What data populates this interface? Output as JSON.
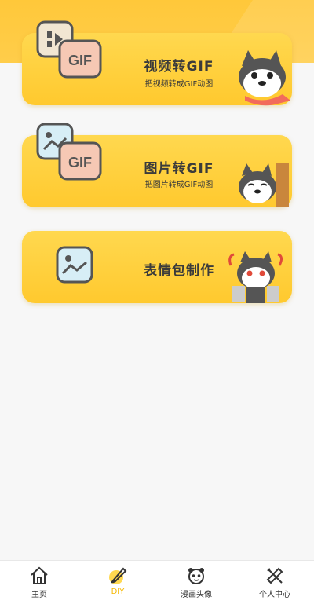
{
  "colors": {
    "accent": "#ffc92e",
    "header": "#ffc83a",
    "active_tab": "#f5b800",
    "text": "#3b3b3b"
  },
  "cards": [
    {
      "title": "视频转GIF",
      "subtitle": "把视频转成GIF动图",
      "badge": "GIF",
      "icon": "video-to-gif-icon",
      "mascot": "husky-scarf-mascot"
    },
    {
      "title": "图片转GIF",
      "subtitle": "把图片转成GIF动图",
      "badge": "GIF",
      "icon": "image-to-gif-icon",
      "mascot": "husky-door-mascot"
    },
    {
      "title": "表情包制作",
      "icon": "image-icon",
      "mascot": "husky-angry-mascot"
    }
  ],
  "tabbar": {
    "items": [
      {
        "label": "主页",
        "icon": "home-icon",
        "active": false
      },
      {
        "label": "DIY",
        "icon": "brush-icon",
        "active": true
      },
      {
        "label": "漫画头像",
        "icon": "panda-avatar-icon",
        "active": false
      },
      {
        "label": "个人中心",
        "icon": "ruler-pencil-icon",
        "active": false
      }
    ]
  }
}
